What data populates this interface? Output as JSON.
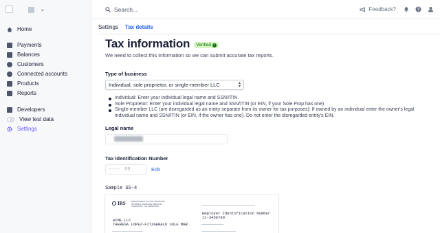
{
  "sidebar": {
    "items": [
      {
        "label": "Home",
        "icon": "home-icon"
      },
      {
        "label": "Payments",
        "icon": "payments-icon"
      },
      {
        "label": "Balances",
        "icon": "balances-icon"
      },
      {
        "label": "Customers",
        "icon": "customers-icon"
      },
      {
        "label": "Connected accounts",
        "icon": "connected-accounts-icon"
      },
      {
        "label": "Products",
        "icon": "products-icon"
      },
      {
        "label": "Reports",
        "icon": "reports-icon"
      },
      {
        "label": "Developers",
        "icon": "developers-icon"
      },
      {
        "label": "View test data",
        "icon": "toggle-icon"
      },
      {
        "label": "Settings",
        "icon": "gear-icon"
      }
    ]
  },
  "topbar": {
    "search_placeholder": "Search...",
    "feedback_label": "Feedback?"
  },
  "breadcrumb": {
    "parent": "Settings",
    "current": "Tax details"
  },
  "page": {
    "title": "Tax information",
    "badge": "Verified",
    "subtitle": "We need to collect this information so we can submit accurate tax reports."
  },
  "business_type": {
    "label": "Type of business",
    "selected": "Individual, sole proprietor, or single-member LLC"
  },
  "bullets": [
    "Individual: Enter your individual legal name and SSN/ITIN.",
    "Sole Proprietor: Enter your individual legal name and SSN/ITIN (or EIN, if your Sole Prop has one)",
    "Single-member LLC (are disregarded as an entity separate from its owner for tax purposes): If owned by an individual enter the owner's legal individual name and SSN/ITIN (or EIN, if the owner has one). Do not enter the disregarded entity's EIN."
  ],
  "legal_name": {
    "label": "Legal name"
  },
  "tin": {
    "label": "Tax Identification Number",
    "masked_prefix": "----",
    "masked_suffix": "89",
    "edit_label": "Edit"
  },
  "sample": {
    "label": "Sample SS-4",
    "irs_logo": "IRS",
    "irs_small": [
      "DEPARTMENT OF THE TREASURY",
      "INTERNAL REVENUE SERVICE",
      "CINCINNATI, OH 45999-0023"
    ],
    "company_line1": "ACME LLC",
    "company_line2": "THERESA LOPEZ-FITZGERALD SOLE MBR",
    "ein_label": "Employer Identification Number",
    "ein_value": "12-3456789"
  },
  "colors": {
    "accent": "#635bff",
    "link": "#2563eb",
    "verified_bg": "#d7f7c2",
    "verified_fg": "#05690d"
  }
}
